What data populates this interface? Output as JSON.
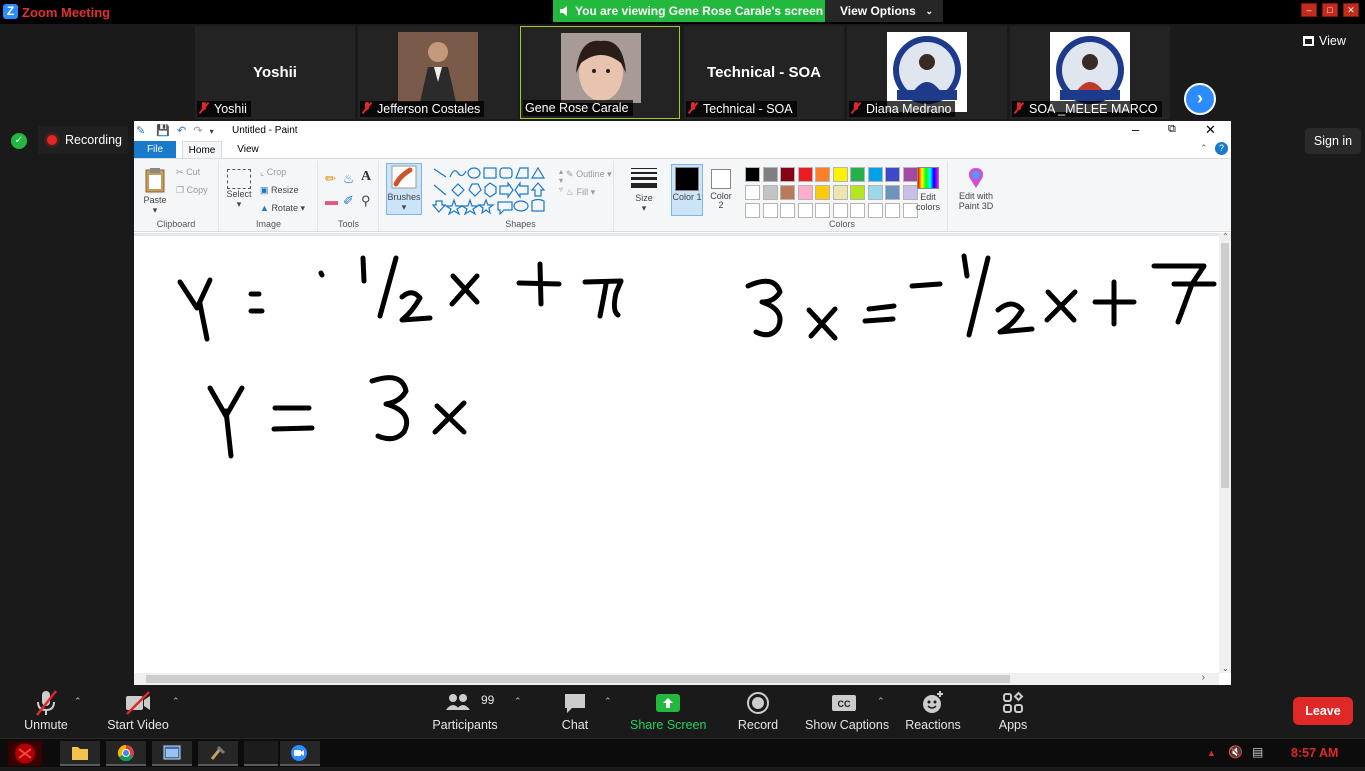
{
  "zoom": {
    "app_title": "Zoom Meeting",
    "banner_text": "You are viewing Gene Rose Carale's screen",
    "view_options_label": "View Options",
    "view_label": "View",
    "recording_label": "Recording",
    "sign_in_label": "Sign in",
    "participants": [
      {
        "big_name": "Yoshii",
        "name": "Yoshii"
      },
      {
        "big_name": "",
        "name": "Jefferson Costales"
      },
      {
        "big_name": "",
        "name": "Gene Rose Carale"
      },
      {
        "big_name": "Technical - SOA",
        "name": "Technical - SOA"
      },
      {
        "big_name": "",
        "name": "Diana Medrano"
      },
      {
        "big_name": "",
        "name": "SOA _MELEE MARCO"
      }
    ],
    "toolbar": {
      "unmute": "Unmute",
      "start_video": "Start Video",
      "participants": "Participants",
      "participants_count": "99",
      "chat": "Chat",
      "share_screen": "Share Screen",
      "record": "Record",
      "show_captions": "Show Captions",
      "reactions": "Reactions",
      "apps": "Apps",
      "leave": "Leave"
    }
  },
  "paint": {
    "title": "Untitled - Paint",
    "tabs": {
      "file": "File",
      "home": "Home",
      "view": "View"
    },
    "clipboard": {
      "paste": "Paste",
      "cut": "Cut",
      "copy": "Copy",
      "group": "Clipboard"
    },
    "image": {
      "select": "Select",
      "crop": "Crop",
      "resize": "Resize",
      "rotate": "Rotate",
      "group": "Image"
    },
    "tools": {
      "group": "Tools"
    },
    "brushes": "Brushes",
    "shapes": {
      "outline": "Outline",
      "fill": "Fill",
      "group": "Shapes"
    },
    "size": "Size",
    "color1": "Color 1",
    "color2": "Color 2",
    "colors_group": "Colors",
    "edit_colors": "Edit colors",
    "edit_paint3d": "Edit with Paint 3D",
    "palette_row1": [
      "#000000",
      "#7f7f7f",
      "#880015",
      "#ed1c24",
      "#ff7f27",
      "#fff200",
      "#22b14c",
      "#00a2e8",
      "#3f48cc",
      "#a349a4"
    ],
    "palette_row2": [
      "#ffffff",
      "#c3c3c3",
      "#b97a57",
      "#ffaec9",
      "#ffc90e",
      "#efe4b0",
      "#b5e61d",
      "#99d9ea",
      "#7092be",
      "#c8bfe7"
    ]
  },
  "taskbar": {
    "time": "8:57 AM"
  }
}
